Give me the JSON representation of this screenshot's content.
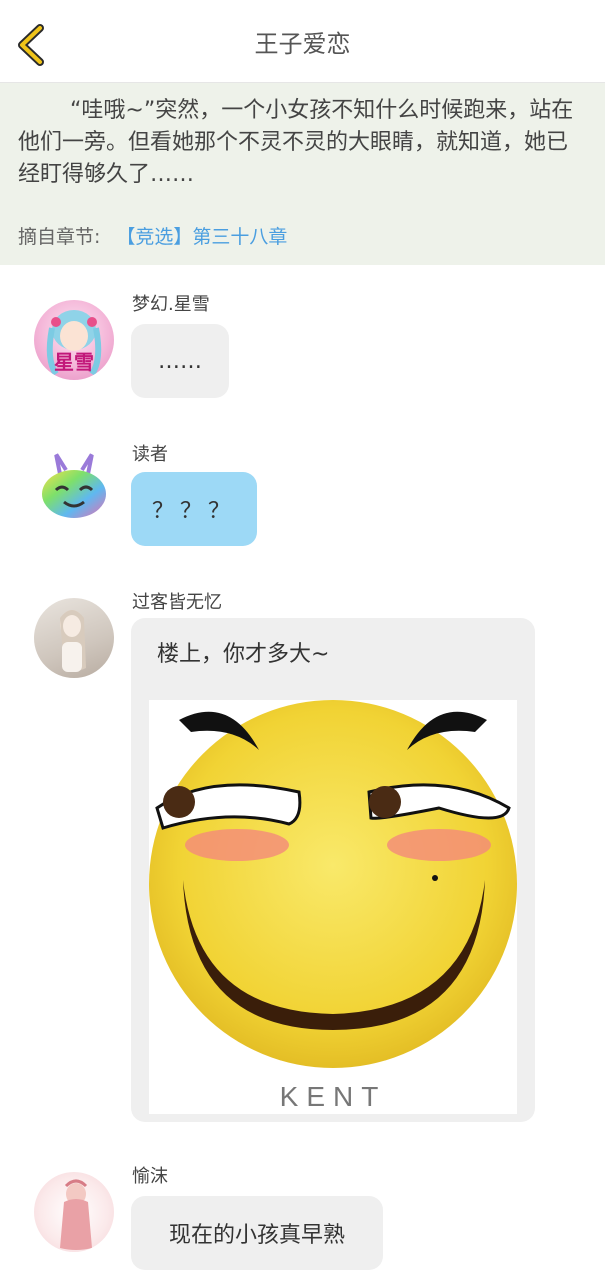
{
  "header": {
    "title": "王子爱恋"
  },
  "excerpt": {
    "text": "“哇哦~”突然，一个小女孩不知什么时候跑来，站在他们一旁。但看她那个不灵不灵的大眼睛，就知道，她已经盯得够久了……",
    "source_label": "摘自章节:",
    "chapter": "【竞选】第三十八章"
  },
  "messages": [
    {
      "name": "梦幻.星雪",
      "text": "……",
      "avatar_text": "星雪"
    },
    {
      "name": "读者",
      "text": "？？？"
    },
    {
      "name": "过客皆无忆",
      "text": "楼上，你才多大~",
      "image_caption": "KENT"
    },
    {
      "name": "愉沫",
      "text": "现在的小孩真早熟"
    }
  ],
  "colors": {
    "accent": "#4a9ee0",
    "reader_bubble": "#9dd9f6",
    "bubble": "#efefef",
    "back_icon": "#f0c419"
  }
}
